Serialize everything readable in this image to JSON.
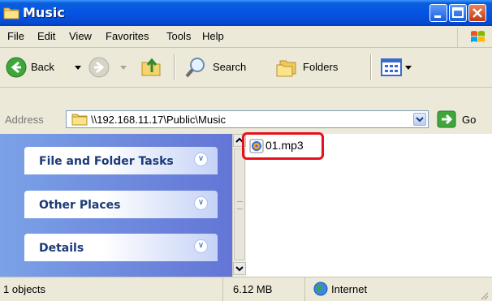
{
  "window": {
    "title": "Music"
  },
  "menu": [
    "File",
    "Edit",
    "View",
    "Favorites",
    "Tools",
    "Help"
  ],
  "toolbar": {
    "back_label": "Back",
    "search_label": "Search",
    "folders_label": "Folders"
  },
  "address": {
    "label": "Address",
    "value": "\\\\192.168.11.17\\Public\\Music",
    "go_label": "Go"
  },
  "tasks": [
    {
      "title": "File and Folder Tasks"
    },
    {
      "title": "Other Places"
    },
    {
      "title": "Details"
    }
  ],
  "files": [
    {
      "name": "01.mp3"
    }
  ],
  "status": {
    "count": "1 objects",
    "size": "6.12 MB",
    "zone": "Internet"
  },
  "colors": {
    "titlebar": "#0554e3",
    "taskpane": "#7ba2e7",
    "highlight": "#e8101c"
  }
}
